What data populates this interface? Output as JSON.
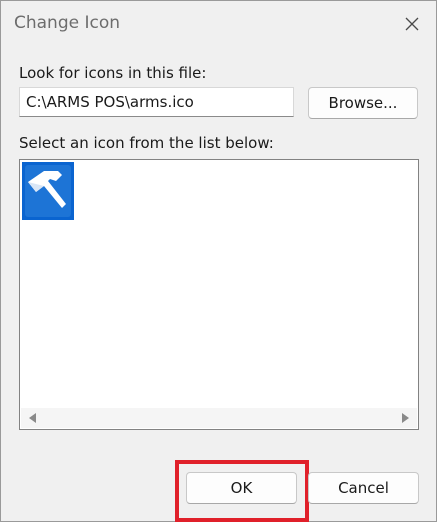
{
  "dialog": {
    "title": "Change Icon",
    "close_icon": "close-icon"
  },
  "file_section": {
    "label": "Look for icons in this file:",
    "path_value": "C:\\ARMS POS\\arms.ico",
    "browse_label": "Browse..."
  },
  "list_section": {
    "label": "Select an icon from the list below:",
    "icons": [
      {
        "name": "hammer-icon",
        "selected": true
      }
    ],
    "scroll_left_icon": "triangle-left-icon",
    "scroll_right_icon": "triangle-right-icon"
  },
  "footer": {
    "ok_label": "OK",
    "cancel_label": "Cancel"
  },
  "colors": {
    "selection": "#0a64d0",
    "highlight": "#e0202a"
  }
}
